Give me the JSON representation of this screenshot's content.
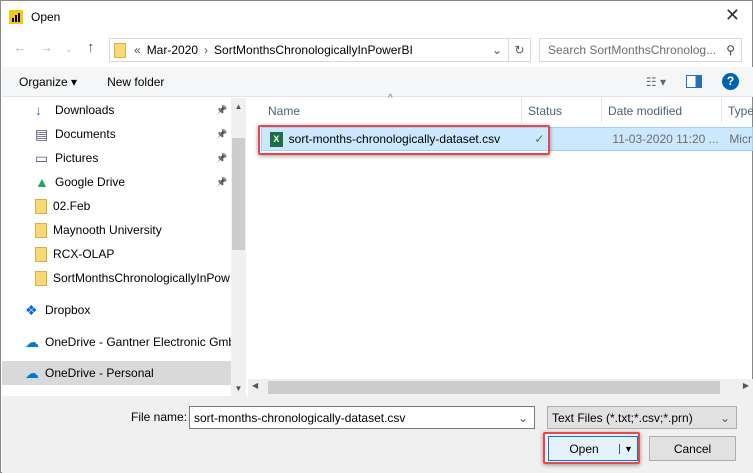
{
  "window": {
    "title": "Open"
  },
  "address": {
    "overflow": "«",
    "path": [
      "Mar-2020",
      "SortMonthsChronologicallyInPowerBI"
    ]
  },
  "search": {
    "placeholder": "Search SortMonthsChronolog..."
  },
  "toolbar": {
    "organize": "Organize",
    "new_folder": "New folder"
  },
  "nav_pane": {
    "items": [
      {
        "label": "Downloads",
        "icon": "download-icon",
        "pinned": true
      },
      {
        "label": "Documents",
        "icon": "documents-icon",
        "pinned": true
      },
      {
        "label": "Pictures",
        "icon": "pictures-icon",
        "pinned": true
      },
      {
        "label": "Google Drive",
        "icon": "google-drive-icon",
        "pinned": true
      },
      {
        "label": "02.Feb",
        "icon": "folder-icon"
      },
      {
        "label": "Maynooth University",
        "icon": "folder-icon"
      },
      {
        "label": "RCX-OLAP",
        "icon": "folder-icon"
      },
      {
        "label": "SortMonthsChronologicallyInPow",
        "icon": "folder-icon"
      },
      {
        "label": "Dropbox",
        "icon": "dropbox-icon"
      },
      {
        "label": "OneDrive - Gantner Electronic Gmb",
        "icon": "onedrive-icon"
      },
      {
        "label": "OneDrive - Personal",
        "icon": "onedrive-icon",
        "selected": true
      }
    ]
  },
  "columns": [
    "Name",
    "Status",
    "Date modified",
    "Type"
  ],
  "files": [
    {
      "name": "sort-months-chronologically-dataset.csv",
      "status": "synced",
      "date": "11-03-2020 11:20 ...",
      "type": "Micr"
    }
  ],
  "footer": {
    "file_name_label": "File name:",
    "file_name_value": "sort-months-chronologically-dataset.csv",
    "filter": "Text Files (*.txt;*.csv;*.prn)",
    "open": "Open",
    "cancel": "Cancel"
  },
  "colors": {
    "highlight": "#e8474c",
    "selection": "#cce8ff",
    "accent": "#0063b1"
  }
}
